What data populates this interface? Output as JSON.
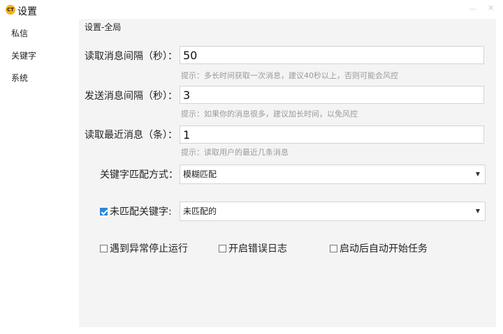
{
  "window": {
    "logo_text": "CT",
    "title": "设置",
    "minimize_symbol": "—",
    "close_symbol": "✕"
  },
  "sidebar": {
    "items": [
      {
        "label": "私信"
      },
      {
        "label": "关键字"
      },
      {
        "label": "系统"
      }
    ]
  },
  "main": {
    "section_title": "设置-全局",
    "read_interval": {
      "label": "读取消息间隔（秒）：",
      "value": "50",
      "hint": "提示：多长时间获取一次消息，建议40秒以上，否则可能会风控"
    },
    "send_interval": {
      "label": "发送消息间隔（秒）：",
      "value": "3",
      "hint": "提示：如果你的消息很多，建议加长时间，以免风控"
    },
    "recent_count": {
      "label": "读取最近消息（条）：",
      "value": "1",
      "hint": "提示：读取用户的最近几条消息"
    },
    "keyword_match": {
      "label": "关键字匹配方式：",
      "selected": "模糊匹配"
    },
    "unmatched_keyword": {
      "label": "未匹配关键字:",
      "checked": true,
      "selected": "未匹配的"
    },
    "options": [
      {
        "label": "遇到异常停止运行",
        "checked": false
      },
      {
        "label": "开启错误日志",
        "checked": false
      },
      {
        "label": "启动后自动开始任务",
        "checked": false
      }
    ]
  },
  "colors": {
    "accent": "#2a86d8",
    "logo": "#f6b11d",
    "panel_bg": "#f4f4f4",
    "hint_text": "#9a9a9a"
  }
}
